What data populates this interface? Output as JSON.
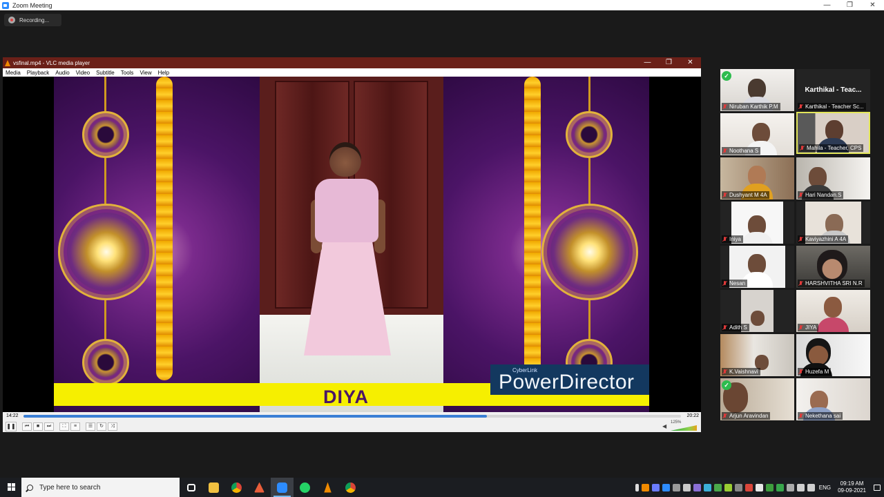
{
  "zoom": {
    "title": "Zoom Meeting",
    "recording_label": "Recording..."
  },
  "window_controls": {
    "minimize": "—",
    "restore": "❐",
    "close": "✕"
  },
  "vlc": {
    "title": "vsfinal.mp4 - VLC media player",
    "menu": [
      "Media",
      "Playback",
      "Audio",
      "Video",
      "Subtitle",
      "Tools",
      "View",
      "Help"
    ],
    "time_current": "14:22",
    "time_total": "20:22",
    "progress_fraction": 0.705,
    "volume_percent": "125%"
  },
  "video": {
    "name_banner": "DIYA",
    "watermark_small": "CyberLink",
    "watermark_big": "PowerDirector"
  },
  "participants": [
    {
      "name": "Niruban Karthik P.M",
      "muted": true,
      "checked": true,
      "video": true
    },
    {
      "name": "Karthikal - Teacher Sc...",
      "big_name": "Karthikal - Teac...",
      "muted": true,
      "video": false
    },
    {
      "name": "Noothana S",
      "muted": true,
      "video": true
    },
    {
      "name": "Mahila - Teacher, CPS",
      "muted": true,
      "video": true,
      "active": true
    },
    {
      "name": "Dushyant M 4A",
      "muted": true,
      "video": true
    },
    {
      "name": "Hari Nandan.S",
      "muted": true,
      "video": true
    },
    {
      "name": "Iniya",
      "muted": true,
      "video": true
    },
    {
      "name": "Kaviyazhini A 4A",
      "muted": true,
      "video": true
    },
    {
      "name": "Nesan",
      "muted": true,
      "video": true
    },
    {
      "name": "HARSHVITHA SRI N.R",
      "muted": true,
      "video": true
    },
    {
      "name": "Adith S",
      "muted": true,
      "video": true
    },
    {
      "name": "JIYA",
      "muted": true,
      "video": true
    },
    {
      "name": "K.Vaishnavi",
      "muted": true,
      "video": true
    },
    {
      "name": "Huzefa M",
      "muted": true,
      "video": true
    },
    {
      "name": "Arjun Aravindan",
      "muted": true,
      "checked": true,
      "video": true
    },
    {
      "name": "Nekethana  sai",
      "muted": true,
      "video": true
    }
  ],
  "taskbar": {
    "search_placeholder": "Type here to search",
    "language": "ENG",
    "time": "09:19 AM",
    "date": "09-09-2021"
  }
}
